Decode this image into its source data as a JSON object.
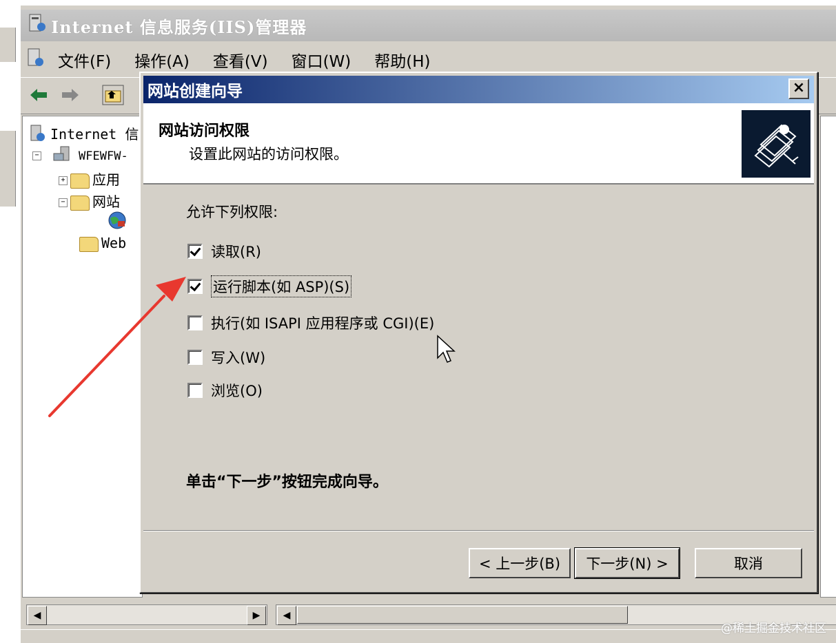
{
  "window": {
    "title": "Internet 信息服务(IIS)管理器",
    "menu": [
      "文件(F)",
      "操作(A)",
      "查看(V)",
      "窗口(W)",
      "帮助(H)"
    ]
  },
  "tree": {
    "root": "Internet 信",
    "server": "WFEWFW-",
    "app_pools": "应用",
    "websites": "网站",
    "web_ext": "Web"
  },
  "dialog": {
    "title": "网站创建向导",
    "close": "×",
    "header_title": "网站访问权限",
    "header_subtitle": "设置此网站的访问权限。",
    "permissions_label": "允许下列权限:",
    "permissions": [
      {
        "label": "读取(R)",
        "checked": true
      },
      {
        "label": "运行脚本(如 ASP)(S)",
        "checked": true
      },
      {
        "label": "执行(如 ISAPI 应用程序或 CGI)(E)",
        "checked": false
      },
      {
        "label": "写入(W)",
        "checked": false
      },
      {
        "label": "浏览(O)",
        "checked": false
      }
    ],
    "finish_text": "单击“下一步”按钮完成向导。",
    "buttons": {
      "back": "< 上一步(B)",
      "next": "下一步(N) >",
      "cancel": "取消"
    }
  },
  "watermark": "@稀土掘金技术社区",
  "colors": {
    "title_gradient_start": "#0a246a",
    "title_gradient_end": "#a6caf0",
    "annotation_arrow": "#e8382f",
    "face": "#d4d0c8"
  }
}
